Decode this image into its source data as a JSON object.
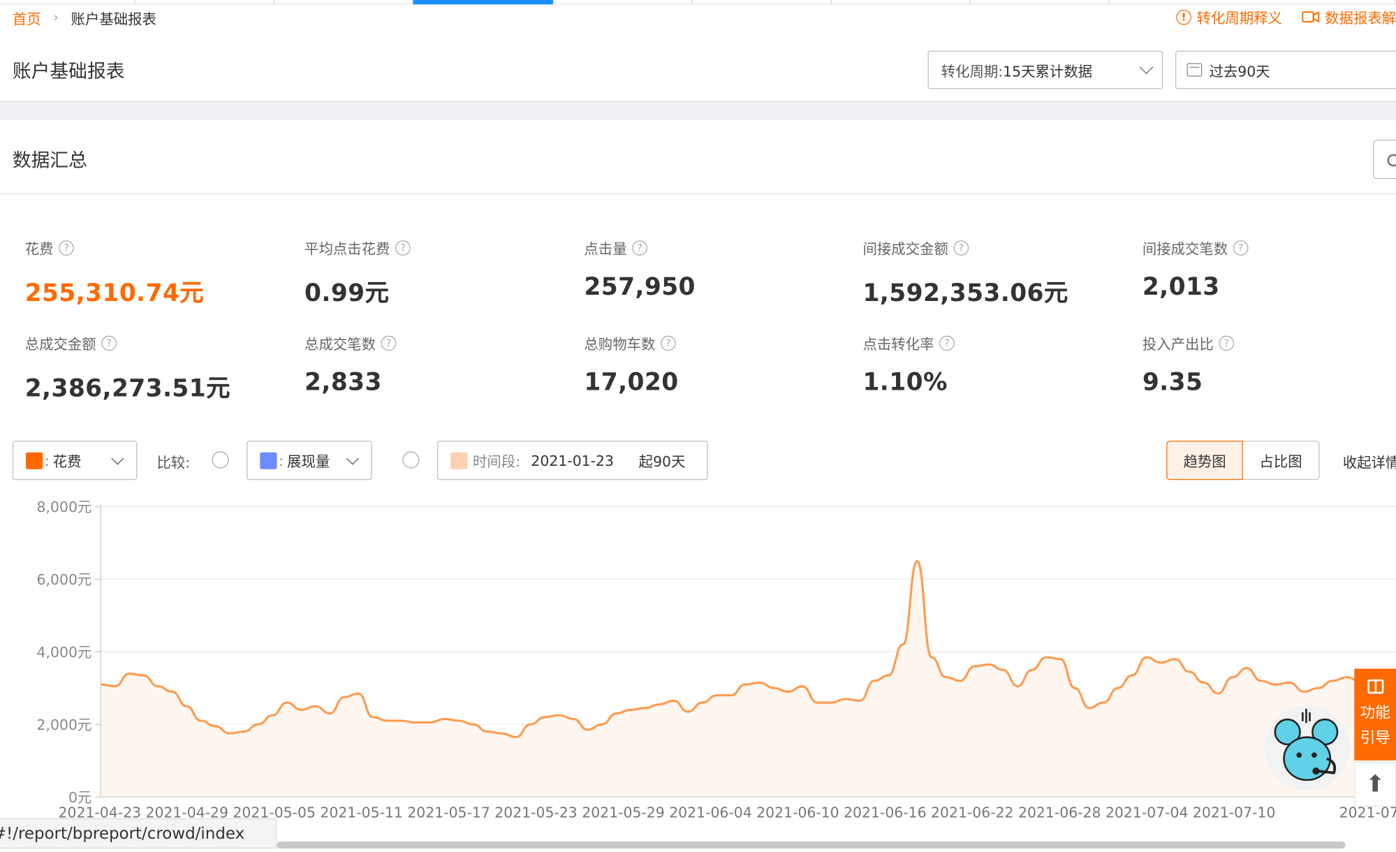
{
  "breadcrumb": {
    "home": "首页",
    "separator": "›",
    "current": "账户基础报表"
  },
  "top_links": {
    "cycle_help": "转化周期释义",
    "report_video": "数据报表解"
  },
  "page_title": "账户基础报表",
  "cycle_select": {
    "label": "转化周期:",
    "value": "15天累计数据"
  },
  "date_select": {
    "value": "过去90天"
  },
  "summary": {
    "title": "数据汇总",
    "metrics": [
      {
        "label": "花费",
        "value": "255,310.74元"
      },
      {
        "label": "平均点击花费",
        "value": "0.99元"
      },
      {
        "label": "点击量",
        "value": "257,950"
      },
      {
        "label": "间接成交金额",
        "value": "1,592,353.06元"
      },
      {
        "label": "间接成交笔数",
        "value": "2,013"
      },
      {
        "label": "总成交金额",
        "value": "2,386,273.51元"
      },
      {
        "label": "总成交笔数",
        "value": "2,833"
      },
      {
        "label": "总购物车数",
        "value": "17,020"
      },
      {
        "label": "点击转化率",
        "value": "1.10%"
      },
      {
        "label": "投入产出比",
        "value": "9.35"
      }
    ]
  },
  "controls": {
    "primary_metric": {
      "sep": ":",
      "label": "花费",
      "color": "#ff6a00"
    },
    "compare_label": "比较:",
    "secondary_metric": {
      "sep": ":",
      "label": "展现量",
      "color": "#6b8cff"
    },
    "period": {
      "label": "时间段:",
      "date": "2021-01-23",
      "suffix": "起90天"
    },
    "view_trend": "趋势图",
    "view_share": "占比图",
    "collapse": "收起详情"
  },
  "side": {
    "guide_line1": "功能",
    "guide_line2": "引导",
    "top_arrow": "⬆"
  },
  "status_url": "#!/report/bpreport/crowd/index",
  "chart_data": {
    "type": "area",
    "series": [
      {
        "values": [
          3100,
          3050,
          3400,
          3350,
          3050,
          2900,
          2500,
          2100,
          1950,
          1750,
          1800,
          2000,
          2250,
          2600,
          2400,
          2500,
          2300,
          2750,
          2850,
          2200,
          2100,
          2100,
          2050,
          2050,
          2150,
          2100,
          2000,
          1800,
          1750,
          1650,
          2000,
          2200,
          2250,
          2150,
          1850,
          2000,
          2300,
          2400,
          2450,
          2550,
          2650,
          2350,
          2600,
          2800,
          2800,
          3100,
          3150,
          3000,
          2900,
          3050,
          2600,
          2600,
          2700,
          2650,
          3200,
          3350,
          4200,
          6500,
          3850,
          3300,
          3200,
          3600,
          3650,
          3500,
          3050,
          3500,
          3850,
          3800,
          3000,
          2450,
          2600,
          3000,
          3350,
          3850,
          3700,
          3800,
          3450,
          3150,
          2850,
          3300,
          3550,
          3200,
          3100,
          3150,
          2900,
          3000,
          3200,
          3300,
          3150,
          3050
        ]
      }
    ],
    "x_tick_labels": [
      "2021-04-23",
      "2021-04-29",
      "2021-05-05",
      "2021-05-11",
      "2021-05-17",
      "2021-05-23",
      "2021-05-29",
      "2021-06-04",
      "2021-06-10",
      "2021-06-16",
      "2021-06-22",
      "2021-06-28",
      "2021-07-04",
      "2021-07-10",
      "2021-07"
    ],
    "y_tick_labels": [
      "8,000元",
      "6,000元",
      "4,000元",
      "2,000元",
      "0元"
    ],
    "ylim": [
      0,
      8000
    ],
    "grid": true,
    "line_color": "#ff9a4d",
    "fill_color": "#fff6f0"
  }
}
